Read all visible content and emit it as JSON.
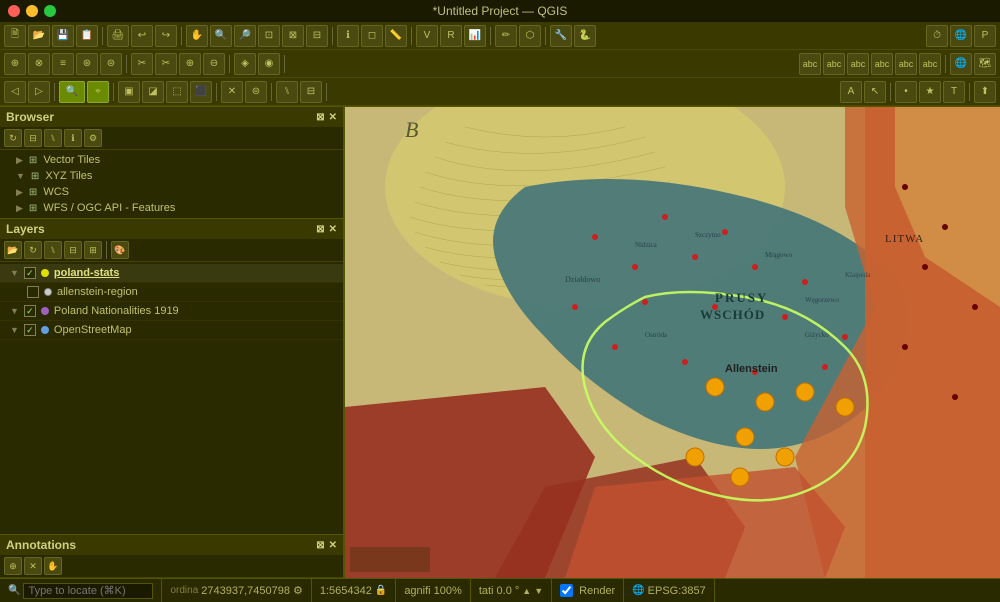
{
  "titleBar": {
    "title": "*Untitled Project — QGIS"
  },
  "toolbar": {
    "rows": [
      {
        "id": "row1"
      },
      {
        "id": "row2"
      },
      {
        "id": "row3"
      }
    ]
  },
  "browser": {
    "title": "Browser",
    "items": [
      {
        "label": "Vector Tiles",
        "icon": "⊞",
        "hasExpand": false
      },
      {
        "label": "XYZ Tiles",
        "icon": "⊞",
        "hasExpand": true
      },
      {
        "label": "WCS",
        "icon": "⊞",
        "hasExpand": false
      },
      {
        "label": "WFS / OGC API - Features",
        "icon": "⊞",
        "hasExpand": false
      }
    ]
  },
  "layers": {
    "title": "Layers",
    "items": [
      {
        "id": "poland-stats",
        "name": "poland-stats",
        "checked": true,
        "bold": true,
        "colorDot": "#e0e000",
        "expand": true
      },
      {
        "id": "allenstein-region",
        "name": "allenstein-region",
        "checked": false,
        "bold": false,
        "colorDot": "#ffffff",
        "expand": false
      },
      {
        "id": "poland-nationalities",
        "name": "Poland Nationalities 1919",
        "checked": true,
        "bold": false,
        "colorDot": "#a060c0",
        "expand": true
      },
      {
        "id": "openstreetmap",
        "name": "OpenStreetMap",
        "checked": true,
        "bold": false,
        "colorDot": "#60a0e0",
        "expand": false
      }
    ]
  },
  "annotations": {
    "title": "Annotations"
  },
  "statusBar": {
    "locate_placeholder": "Type to locate (⌘K)",
    "coordinates": "2743937,7450798",
    "scale": "1:5654342",
    "magnification": "agnifi 100%",
    "rotation": "tati 0.0 °",
    "render": "Render",
    "epsg": "EPSG:3857"
  },
  "map": {
    "region_label": "PRUSY\nWSCHÓD",
    "city_label": "Allenstein",
    "top_label": "B"
  }
}
